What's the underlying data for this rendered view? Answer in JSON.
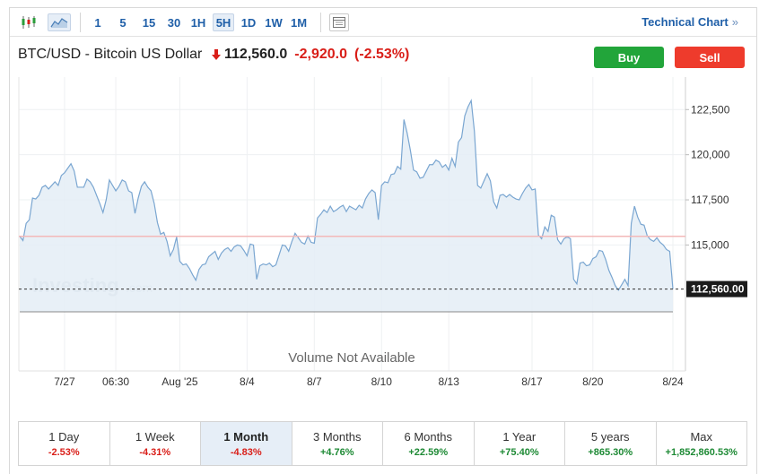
{
  "toolbar": {
    "candle_icon": "candlestick-icon",
    "area_icon": "area-chart-icon",
    "settings_icon": "chart-settings-icon",
    "timeframes": [
      "1",
      "5",
      "15",
      "30",
      "1H",
      "5H",
      "1D",
      "1W",
      "1M"
    ],
    "active_timeframe": "5H",
    "technical_link": "Technical Chart",
    "technical_chevron": "»"
  },
  "header": {
    "title": "BTC/USD - Bitcoin US Dollar",
    "price": "112,560.0",
    "change": "-2,920.0",
    "change_pct": "(-2.53%)",
    "buy_label": "Buy",
    "sell_label": "Sell"
  },
  "chart_data": {
    "type": "area",
    "watermark": "Investing",
    "watermark_suffix": ".com",
    "volume_text": "Volume Not Available",
    "last_price_label": "112,560.00",
    "last_price": 112560,
    "reference_line": 115480,
    "ylim": [
      111300,
      124300
    ],
    "y_ticks": [
      {
        "value": 122500,
        "label": "122,500"
      },
      {
        "value": 120000,
        "label": "120,000"
      },
      {
        "value": 117500,
        "label": "117,500"
      },
      {
        "value": 115000,
        "label": "115,000"
      }
    ],
    "x_ticks": [
      "7/27",
      "06:30",
      "Aug '25",
      "8/4",
      "8/7",
      "8/10",
      "8/13",
      "8/17",
      "8/20",
      "8/24"
    ],
    "x_tick_index": [
      14,
      30,
      50,
      71,
      92,
      113,
      134,
      160,
      179,
      204
    ],
    "values": [
      115480,
      115250,
      116200,
      116400,
      117600,
      117550,
      117750,
      118200,
      118300,
      118100,
      118300,
      118500,
      118300,
      118850,
      119000,
      119250,
      119500,
      119100,
      118200,
      118200,
      118200,
      118650,
      118500,
      118200,
      117750,
      117300,
      116800,
      117500,
      118600,
      118300,
      118000,
      118250,
      118600,
      118500,
      118000,
      117900,
      116750,
      117600,
      118250,
      118500,
      118200,
      118000,
      117300,
      116250,
      115600,
      115700,
      115200,
      114400,
      114750,
      115450,
      114100,
      113900,
      113950,
      113700,
      113350,
      113050,
      113650,
      113900,
      113950,
      114350,
      114500,
      114650,
      114200,
      114550,
      114750,
      114850,
      114650,
      114900,
      115000,
      114950,
      114700,
      114400,
      115050,
      115000,
      113100,
      113850,
      113950,
      113900,
      114000,
      113800,
      113900,
      114450,
      115000,
      114950,
      114650,
      115200,
      115650,
      115400,
      115150,
      115050,
      115500,
      115150,
      115100,
      116500,
      116700,
      116950,
      116800,
      117150,
      116850,
      116950,
      117100,
      117200,
      116850,
      117150,
      117050,
      116950,
      117200,
      117050,
      117550,
      117850,
      118050,
      117900,
      116400,
      118300,
      118500,
      118450,
      118900,
      118950,
      119350,
      119200,
      121950,
      121200,
      120250,
      119150,
      119050,
      118700,
      118750,
      119100,
      119450,
      119450,
      119700,
      119600,
      119300,
      119450,
      119150,
      119800,
      119350,
      120700,
      120950,
      122150,
      122650,
      123000,
      121300,
      118300,
      118150,
      118550,
      118950,
      118550,
      117400,
      117050,
      117750,
      117800,
      117650,
      117800,
      117650,
      117550,
      117500,
      117850,
      118150,
      118350,
      118050,
      118100,
      115550,
      115350,
      116000,
      115750,
      116650,
      116550,
      115300,
      115050,
      115350,
      115450,
      115350,
      113100,
      112850,
      114000,
      114050,
      113850,
      113900,
      114250,
      114350,
      114700,
      114650,
      114200,
      113600,
      113200,
      112750,
      112500,
      112800,
      113100,
      112750,
      116200,
      117150,
      116550,
      116150,
      116100,
      115500,
      115300,
      115200,
      115400,
      115150,
      115000,
      114750,
      114650,
      112560
    ]
  },
  "periods": [
    {
      "label": "1 Day",
      "value": "-2.53%",
      "dir": "neg"
    },
    {
      "label": "1 Week",
      "value": "-4.31%",
      "dir": "neg"
    },
    {
      "label": "1 Month",
      "value": "-4.83%",
      "dir": "neg"
    },
    {
      "label": "3 Months",
      "value": "+4.76%",
      "dir": "pos"
    },
    {
      "label": "6 Months",
      "value": "+22.59%",
      "dir": "pos"
    },
    {
      "label": "1 Year",
      "value": "+75.40%",
      "dir": "pos"
    },
    {
      "label": "5 years",
      "value": "+865.30%",
      "dir": "pos"
    },
    {
      "label": "Max",
      "value": "+1,852,860.53%",
      "dir": "pos"
    }
  ],
  "active_period": "1 Month",
  "colors": {
    "line": "#7aa6d1",
    "fill": "#e4edf6",
    "grid": "#eef0f2",
    "reference": "#f3b8b8",
    "accent": "#1f5fa8",
    "negative": "#d91e18",
    "positive": "#1e8a35",
    "buy": "#22a53a",
    "sell": "#ee3b2c"
  }
}
